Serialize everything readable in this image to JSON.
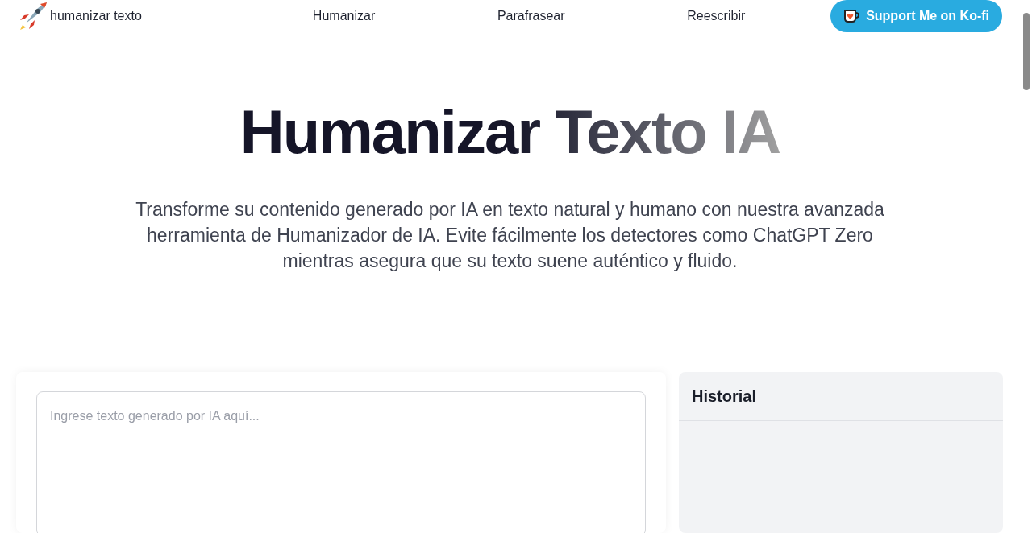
{
  "header": {
    "logo_text": "humanizar texto",
    "nav": [
      {
        "label": "Humanizar"
      },
      {
        "label": "Parafrasear"
      },
      {
        "label": "Reescribir"
      }
    ],
    "support_button": "Support Me on Ko-fi"
  },
  "hero": {
    "title": "Humanizar Texto IA",
    "subtitle": "Transforme su contenido generado por IA en texto natural y humano con nuestra avanzada herramienta de Humanizador de IA. Evite fácilmente los detectores como ChatGPT Zero mientras asegura que su texto suene auténtico y fluido."
  },
  "editor": {
    "placeholder": "Ingrese texto generado por IA aquí..."
  },
  "history": {
    "title": "Historial"
  }
}
